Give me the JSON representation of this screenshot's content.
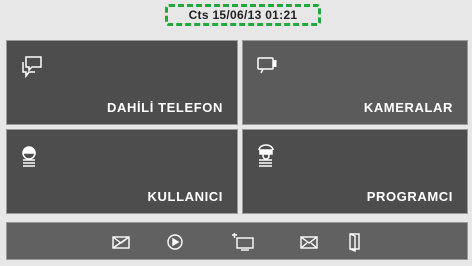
{
  "status": {
    "text": "Cts 15/06/13 01:21",
    "highlight_color": "#21a83a"
  },
  "tiles": [
    {
      "label": "DAHİLİ TELEFON",
      "icon": "chat-bubbles-icon"
    },
    {
      "label": "KAMERALAR",
      "icon": "video-camera-icon"
    },
    {
      "label": "KULLANICI",
      "icon": "user-icon"
    },
    {
      "label": "PROGRAMCI",
      "icon": "installer-icon"
    }
  ],
  "bottom_bar": {
    "buttons": [
      {
        "icon": "message-off-icon"
      },
      {
        "icon": "ringtone-icon"
      },
      {
        "icon": "monitor-settings-icon"
      },
      {
        "icon": "mail-icon"
      },
      {
        "icon": "door-icon"
      }
    ]
  }
}
